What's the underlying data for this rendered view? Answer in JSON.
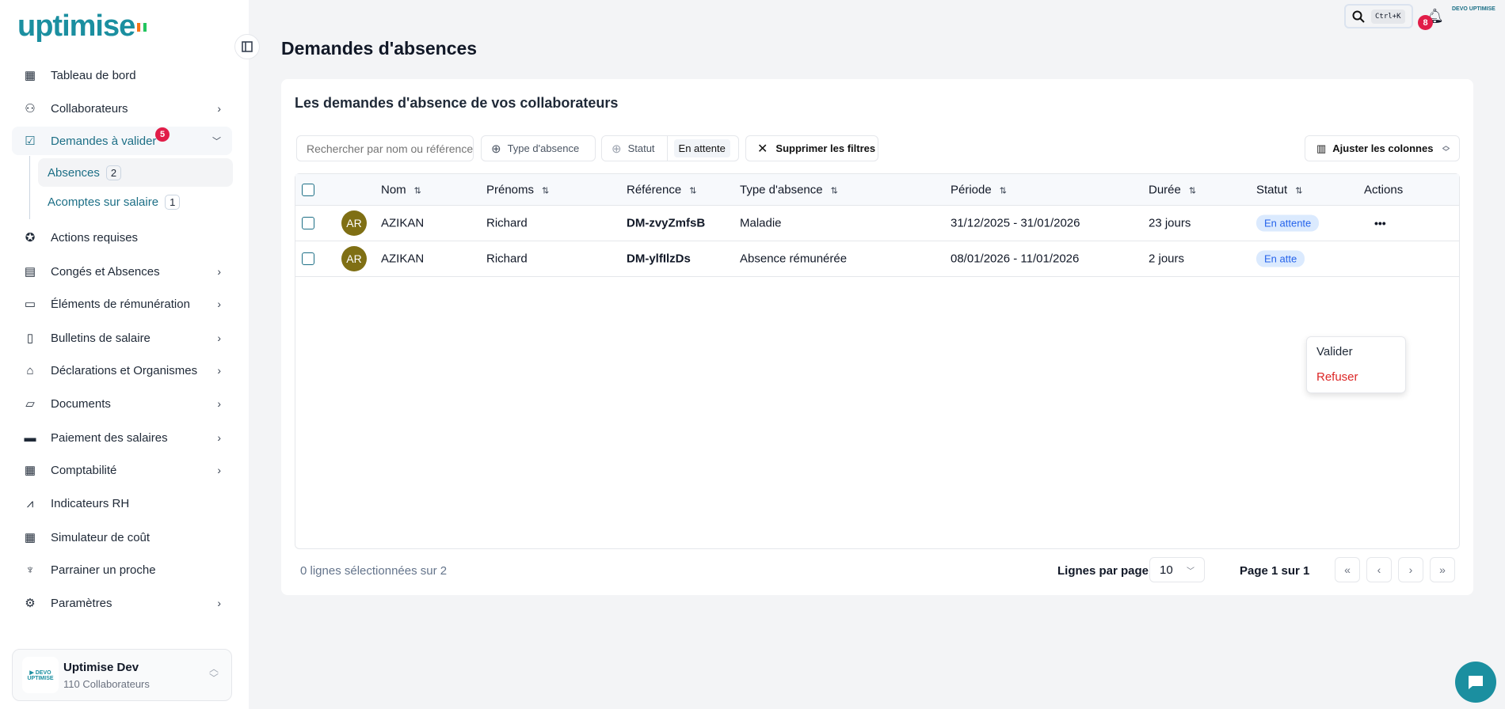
{
  "brand": {
    "name": "uptimise",
    "flag_colors": [
      "#f97316",
      "#ffffff",
      "#22c55e"
    ]
  },
  "topbar": {
    "shortcut": "Ctrl+K",
    "notifications": "8",
    "org_logo_text": "DEVO UPTIMISE"
  },
  "sidebar": {
    "items": [
      {
        "label": "Tableau de bord",
        "icon": "grid-icon"
      },
      {
        "label": "Collaborateurs",
        "icon": "users-icon",
        "chevron": true
      },
      {
        "label": "Demandes à valider",
        "icon": "checklist-icon",
        "badge": "5",
        "expanded": true
      },
      {
        "label": "Actions requises",
        "icon": "badge-check-icon"
      },
      {
        "label": "Congés et Absences",
        "icon": "calendar-icon",
        "chevron": true
      },
      {
        "label": "Éléments de rémunération",
        "icon": "money-icon",
        "chevron": true
      },
      {
        "label": "Bulletins de salaire",
        "icon": "payslip-icon",
        "chevron": true
      },
      {
        "label": "Déclarations et Organismes",
        "icon": "building-icon",
        "chevron": true
      },
      {
        "label": "Documents",
        "icon": "folder-icon",
        "chevron": true
      },
      {
        "label": "Paiement des salaires",
        "icon": "card-icon",
        "chevron": true
      },
      {
        "label": "Comptabilité",
        "icon": "calculator-icon",
        "chevron": true
      },
      {
        "label": "Indicateurs RH",
        "icon": "chart-icon"
      },
      {
        "label": "Simulateur de coût",
        "icon": "calculator-icon"
      },
      {
        "label": "Parrainer un proche",
        "icon": "award-icon"
      },
      {
        "label": "Paramètres",
        "icon": "gear-icon",
        "chevron": true
      }
    ],
    "sub_items": [
      {
        "label": "Absences",
        "count": "2"
      },
      {
        "label": "Acomptes sur salaire",
        "count": "1"
      }
    ],
    "org": {
      "name": "Uptimise Dev",
      "subtitle": "110 Collaborateurs",
      "logo_text": "DEVO UPTIMISE"
    }
  },
  "page": {
    "title": "Demandes d'absences",
    "card_title": "Les demandes d'absence de vos collaborateurs"
  },
  "filters": {
    "search_placeholder": "Rechercher par nom ou référence",
    "type_label": "Type d'absence",
    "status_label": "Statut",
    "status_value": "En attente",
    "clear_label": "Supprimer les filtres",
    "columns_label": "Ajuster les colonnes"
  },
  "table": {
    "headers": [
      "Nom",
      "Prénoms",
      "Référence",
      "Type d'absence",
      "Période",
      "Durée",
      "Statut",
      "Actions"
    ],
    "rows": [
      {
        "initials": "AR",
        "nom": "AZIKAN",
        "prenoms": "Richard",
        "reference": "DM-zvyZmfsB",
        "type": "Maladie",
        "periode": "31/12/2025 - 31/01/2026",
        "duree": "23 jours",
        "statut": "En attente"
      },
      {
        "initials": "AR",
        "nom": "AZIKAN",
        "prenoms": "Richard",
        "reference": "DM-ylfIlzDs",
        "type": "Absence rémunérée",
        "periode": "08/01/2026 - 11/01/2026",
        "duree": "2 jours",
        "statut": "En atte"
      }
    ],
    "action_menu": [
      "Valider",
      "Refuser"
    ]
  },
  "footer": {
    "selection": "0 lignes sélectionnées sur 2",
    "rows_per_page_label": "Lignes par page",
    "rows_per_page": "10",
    "page_info": "Page 1 sur 1"
  }
}
